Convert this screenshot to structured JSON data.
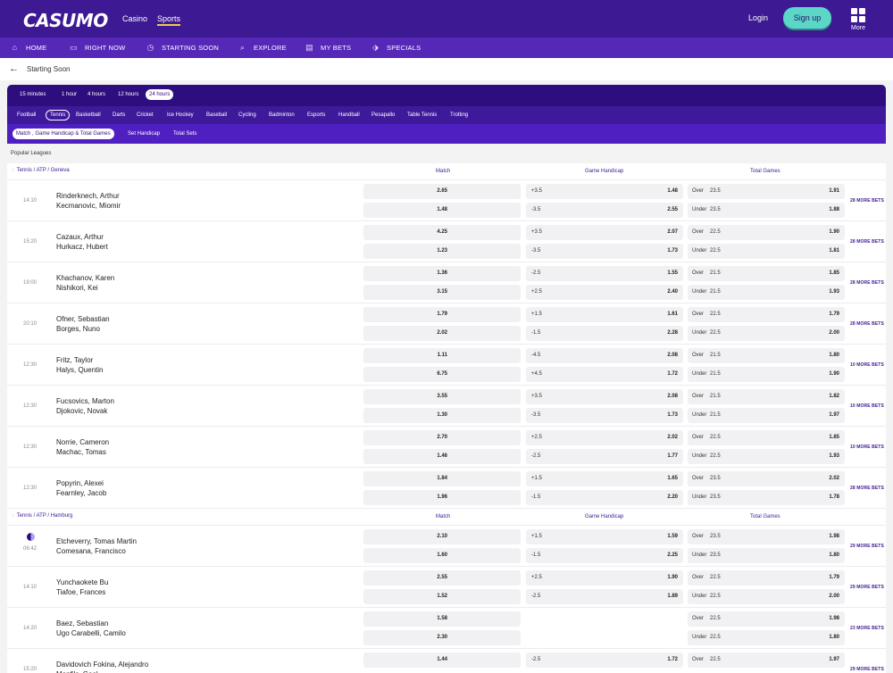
{
  "brand": "CASUMO",
  "header": {
    "casino": "Casino",
    "sports": "Sports",
    "login": "Login",
    "signup": "Sign up",
    "more": "More"
  },
  "nav": [
    "HOME",
    "RIGHT NOW",
    "STARTING SOON",
    "EXPLORE",
    "MY BETS",
    "SPECIALS"
  ],
  "breadcrumb": {
    "title": "Starting Soon"
  },
  "time_filters": [
    "15 minutes",
    "1 hour",
    "4 hours",
    "12 hours",
    "24 hours"
  ],
  "selected_time": "24 hours",
  "sports": [
    "Football",
    "Tennis",
    "Basketball",
    "Darts",
    "Cricket",
    "Ice Hockey",
    "Baseball",
    "Cycling",
    "Badminton",
    "Esports",
    "Handball",
    "Pesapallo",
    "Table Tennis",
    "Trotting"
  ],
  "selected_sport": "Tennis",
  "markets": [
    "Match , Game Handicap & Total Games",
    "Set Handicap",
    "Total Sets"
  ],
  "selected_market": "Match , Game Handicap & Total Games",
  "popular_label": "Popular Leagues",
  "columns": {
    "match": "Match",
    "handicap": "Game Handicap",
    "total": "Total Games"
  },
  "leagues": [
    {
      "name": "Tennis / ATP / Geneva",
      "matches": [
        {
          "time": "14:10",
          "home": "Rinderknech, Arthur",
          "away": "Kecmanovic, Miomir",
          "ml": [
            "2.65",
            "1.48"
          ],
          "hc": [
            [
              "+3.5",
              "1.48"
            ],
            [
              "-3.5",
              "2.55"
            ]
          ],
          "tg": [
            [
              "Over",
              "23.5",
              "1.91"
            ],
            [
              "Under",
              "23.5",
              "1.88"
            ]
          ],
          "more": "28 MORE BETS"
        },
        {
          "time": "15:20",
          "home": "Cazaux, Arthur",
          "away": "Hurkacz, Hubert",
          "ml": [
            "4.25",
            "1.23"
          ],
          "hc": [
            [
              "+3.5",
              "2.07"
            ],
            [
              "-3.5",
              "1.73"
            ]
          ],
          "tg": [
            [
              "Over",
              "22.5",
              "1.90"
            ],
            [
              "Under",
              "22.5",
              "1.81"
            ]
          ],
          "more": "28 MORE BETS"
        },
        {
          "time": "19:00",
          "home": "Khachanov, Karen",
          "away": "Nishikori, Kei",
          "ml": [
            "1.36",
            "3.15"
          ],
          "hc": [
            [
              "-2.5",
              "1.55"
            ],
            [
              "+2.5",
              "2.40"
            ]
          ],
          "tg": [
            [
              "Over",
              "21.5",
              "1.85"
            ],
            [
              "Under",
              "21.5",
              "1.93"
            ]
          ],
          "more": "28 MORE BETS"
        },
        {
          "time": "20:10",
          "home": "Ofner, Sebastian",
          "away": "Borges, Nuno",
          "ml": [
            "1.79",
            "2.02"
          ],
          "hc": [
            [
              "+1.5",
              "1.61"
            ],
            [
              "-1.5",
              "2.28"
            ]
          ],
          "tg": [
            [
              "Over",
              "22.5",
              "1.79"
            ],
            [
              "Under",
              "22.5",
              "2.00"
            ]
          ],
          "more": "28 MORE BETS"
        },
        {
          "time": "12:30",
          "home": "Fritz, Taylor",
          "away": "Halys, Quentin",
          "ml": [
            "1.11",
            "6.75"
          ],
          "hc": [
            [
              "-4.5",
              "2.08"
            ],
            [
              "+4.5",
              "1.72"
            ]
          ],
          "tg": [
            [
              "Over",
              "21.5",
              "1.80"
            ],
            [
              "Under",
              "21.5",
              "1.90"
            ]
          ],
          "more": "10 MORE BETS"
        },
        {
          "time": "12:30",
          "home": "Fucsovics, Marton",
          "away": "Djokovic, Novak",
          "ml": [
            "3.55",
            "1.30"
          ],
          "hc": [
            [
              "+3.5",
              "2.08"
            ],
            [
              "-3.5",
              "1.73"
            ]
          ],
          "tg": [
            [
              "Over",
              "21.5",
              "1.82"
            ],
            [
              "Under",
              "21.5",
              "1.97"
            ]
          ],
          "more": "10 MORE BETS"
        },
        {
          "time": "12:30",
          "home": "Norrie, Cameron",
          "away": "Machac, Tomas",
          "ml": [
            "2.70",
            "1.46"
          ],
          "hc": [
            [
              "+2.5",
              "2.02"
            ],
            [
              "-2.5",
              "1.77"
            ]
          ],
          "tg": [
            [
              "Over",
              "22.5",
              "1.85"
            ],
            [
              "Under",
              "22.5",
              "1.93"
            ]
          ],
          "more": "10 MORE BETS"
        },
        {
          "time": "12:30",
          "home": "Popyrin, Alexei",
          "away": "Fearnley, Jacob",
          "ml": [
            "1.84",
            "1.96"
          ],
          "hc": [
            [
              "+1.5",
              "1.65"
            ],
            [
              "-1.5",
              "2.20"
            ]
          ],
          "tg": [
            [
              "Over",
              "23.5",
              "2.02"
            ],
            [
              "Under",
              "23.5",
              "1.78"
            ]
          ],
          "more": "28 MORE BETS"
        }
      ]
    },
    {
      "name": "Tennis / ATP / Hamburg",
      "matches": [
        {
          "time": "06:42",
          "live": true,
          "home": "Etcheverry, Tomas Martin",
          "away": "Comesana, Francisco",
          "ml": [
            "2.10",
            "1.60"
          ],
          "hc": [
            [
              "+1.5",
              "1.59"
            ],
            [
              "-1.5",
              "2.25"
            ]
          ],
          "tg": [
            [
              "Over",
              "23.5",
              "1.98"
            ],
            [
              "Under",
              "23.5",
              "1.80"
            ]
          ],
          "more": "29 MORE BETS"
        },
        {
          "time": "14:10",
          "home": "Yunchaokete Bu",
          "away": "Tiafoe, Frances",
          "ml": [
            "2.55",
            "1.52"
          ],
          "hc": [
            [
              "+2.5",
              "1.90"
            ],
            [
              "-2.5",
              "1.89"
            ]
          ],
          "tg": [
            [
              "Over",
              "22.5",
              "1.79"
            ],
            [
              "Under",
              "22.5",
              "2.00"
            ]
          ],
          "more": "29 MORE BETS"
        },
        {
          "time": "14:20",
          "home": "Baez, Sebastian",
          "away": "Ugo Carabelli, Camilo",
          "ml": [
            "1.58",
            "2.30"
          ],
          "hc": [],
          "tg": [
            [
              "Over",
              "22.5",
              "1.98"
            ],
            [
              "Under",
              "22.5",
              "1.80"
            ]
          ],
          "more": "23 MORE BETS"
        },
        {
          "time": "15:20",
          "home": "Davidovich Fokina, Alejandro",
          "away": "Monfils, Gael",
          "ml": [
            "1.44",
            ""
          ],
          "hc": [
            [
              "-2.5",
              "1.72"
            ],
            [
              "",
              ""
            ]
          ],
          "tg": [
            [
              "Over",
              "22.5",
              "1.97"
            ],
            [
              "",
              "",
              ""
            ]
          ],
          "more": "29 MORE BETS"
        }
      ]
    }
  ]
}
